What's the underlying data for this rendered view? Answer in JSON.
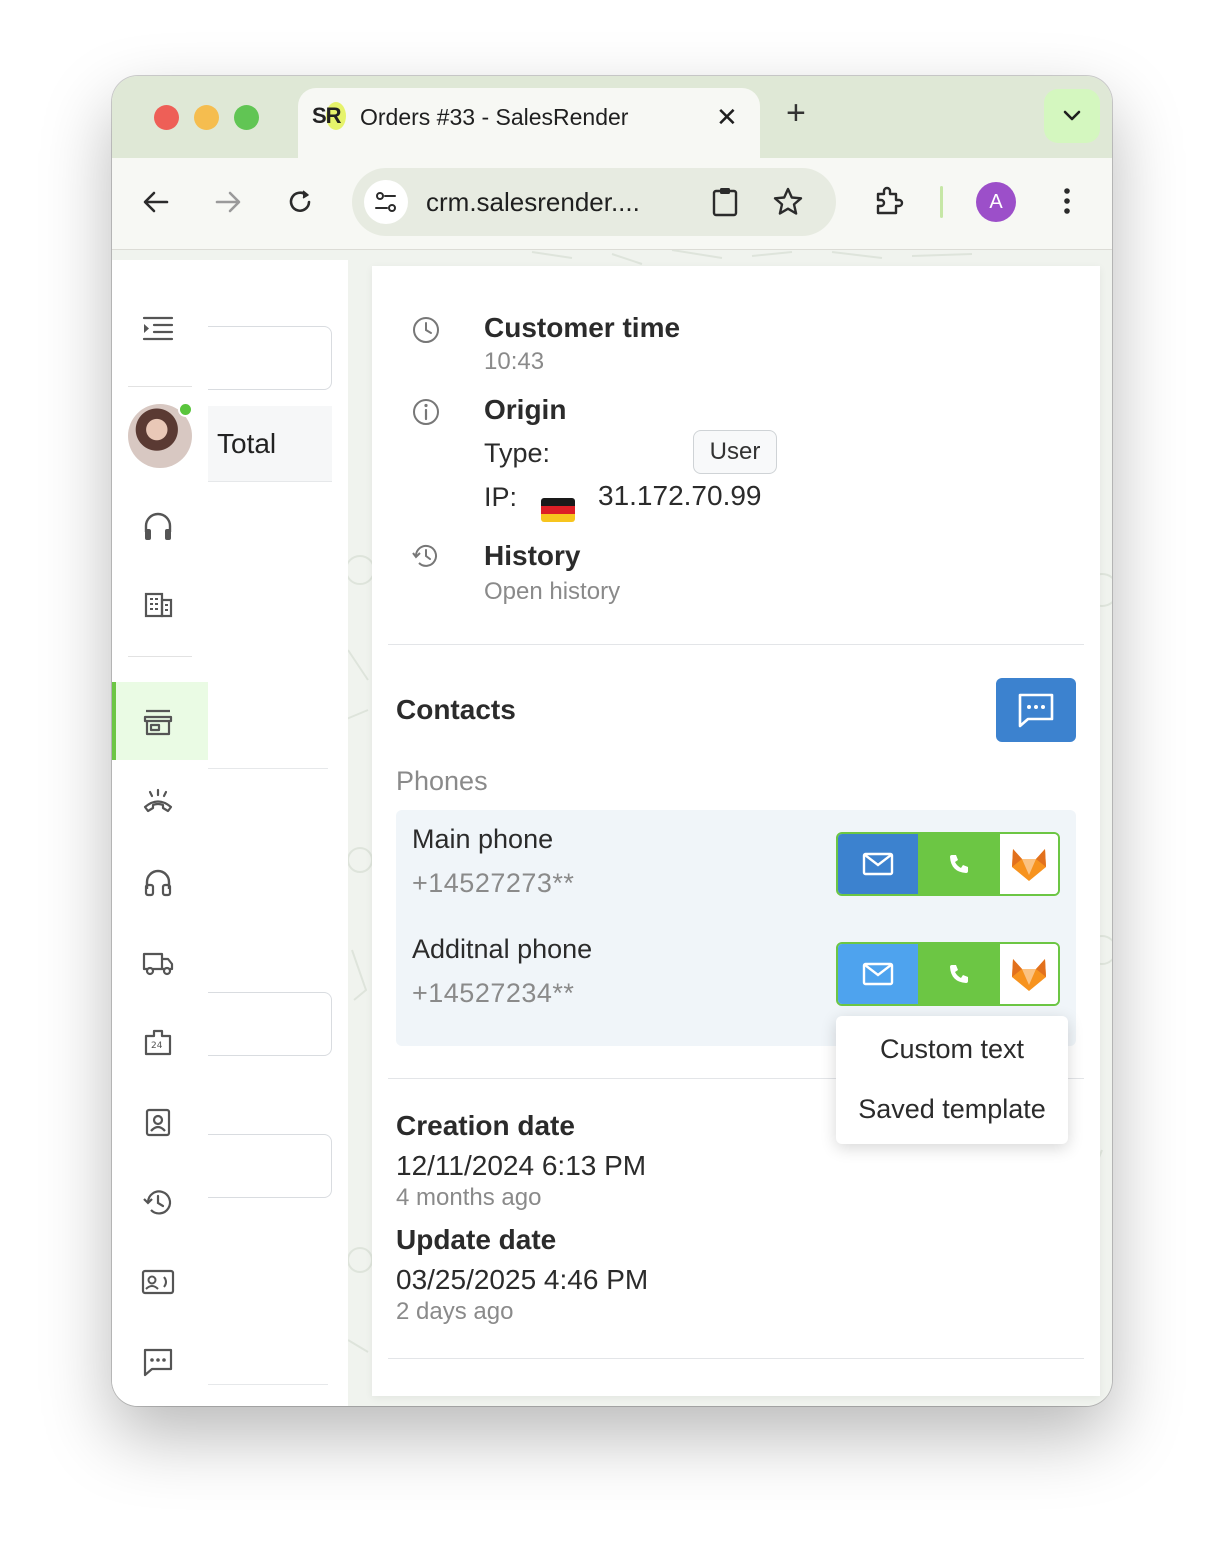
{
  "browser": {
    "tab_title": "Orders #33 - SalesRender",
    "tab_favicon": "SR",
    "url": "crm.salesrender....",
    "profile_initial": "A",
    "colors": {
      "tabstrip": "#dfe8d6",
      "profile": "#9c4fc9",
      "tab_menu": "#d4f7bf"
    }
  },
  "listpanel": {
    "total_label": "Total"
  },
  "order": {
    "customer_time": {
      "title": "Customer time",
      "value": "10:43"
    },
    "origin": {
      "title": "Origin",
      "type_label": "Type:",
      "type_value": "User",
      "ip_label": "IP:",
      "ip_value": "31.172.70.99",
      "flag": "germany-flag"
    },
    "history": {
      "title": "History",
      "link": "Open history"
    },
    "contacts": {
      "title": "Contacts",
      "phones_label": "Phones",
      "phones": [
        {
          "name": "Main phone",
          "number": "+14527273**"
        },
        {
          "name": "Additnal phone",
          "number": "+14527234**"
        }
      ],
      "menu": [
        "Custom text",
        "Saved template"
      ]
    },
    "dates": {
      "creation": {
        "title": "Creation date",
        "value": "12/11/2024 6:13 PM",
        "ago": "4 months ago"
      },
      "update": {
        "title": "Update date",
        "value": "03/25/2025 4:46 PM",
        "ago": "2 days ago"
      }
    }
  },
  "colors": {
    "accent_blue": "#3c82cf",
    "accent_green": "#6cc644",
    "active_nav": "#eafbe4"
  }
}
